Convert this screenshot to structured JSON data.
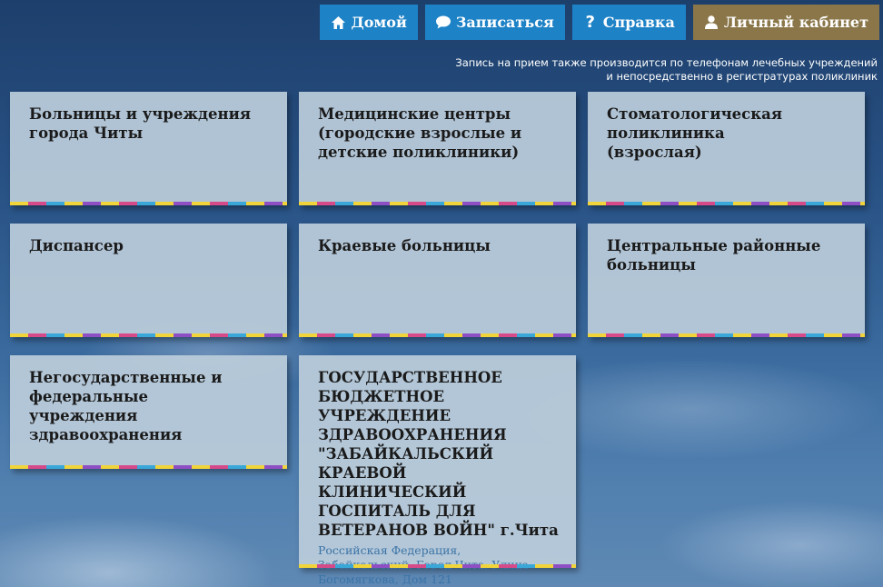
{
  "nav": {
    "home": "Домой",
    "signup": "Записаться",
    "help": "Справка",
    "cabinet": "Личный кабинет"
  },
  "notice": {
    "line1": "Запись на прием также производится по телефонам лечебных учреждений",
    "line2": "и непосредственно в регистратурах поликлиник"
  },
  "tiles": [
    {
      "title": "Больницы и учреждения города Читы"
    },
    {
      "title": "Медицинские центры (городские взрослые и детские поликлиники)"
    },
    {
      "title": "Стоматологическая поликлиника (взрослая)"
    },
    {
      "title": "Диспансер"
    },
    {
      "title": "Краевые больницы"
    },
    {
      "title": "Центральные районные больницы"
    },
    {
      "title": "Негосударственные и федеральные учреждения здравоохранения"
    },
    {
      "title": "ГОСУДАРСТВЕННОЕ БЮДЖЕТНОЕ УЧРЕЖДЕНИЕ ЗДРАВООХРАНЕНИЯ \"ЗАБАЙКАЛЬСКИЙ КРАЕВОЙ КЛИНИЧЕСКИЙ ГОСПИТАЛЬ ДЛЯ ВЕТЕРАНОВ ВОЙН\"",
      "city": "г.Чита",
      "address": "Российская Федерация, Забайкальский, Город Чита, Улица Богомягкова, Дом 121"
    }
  ]
}
